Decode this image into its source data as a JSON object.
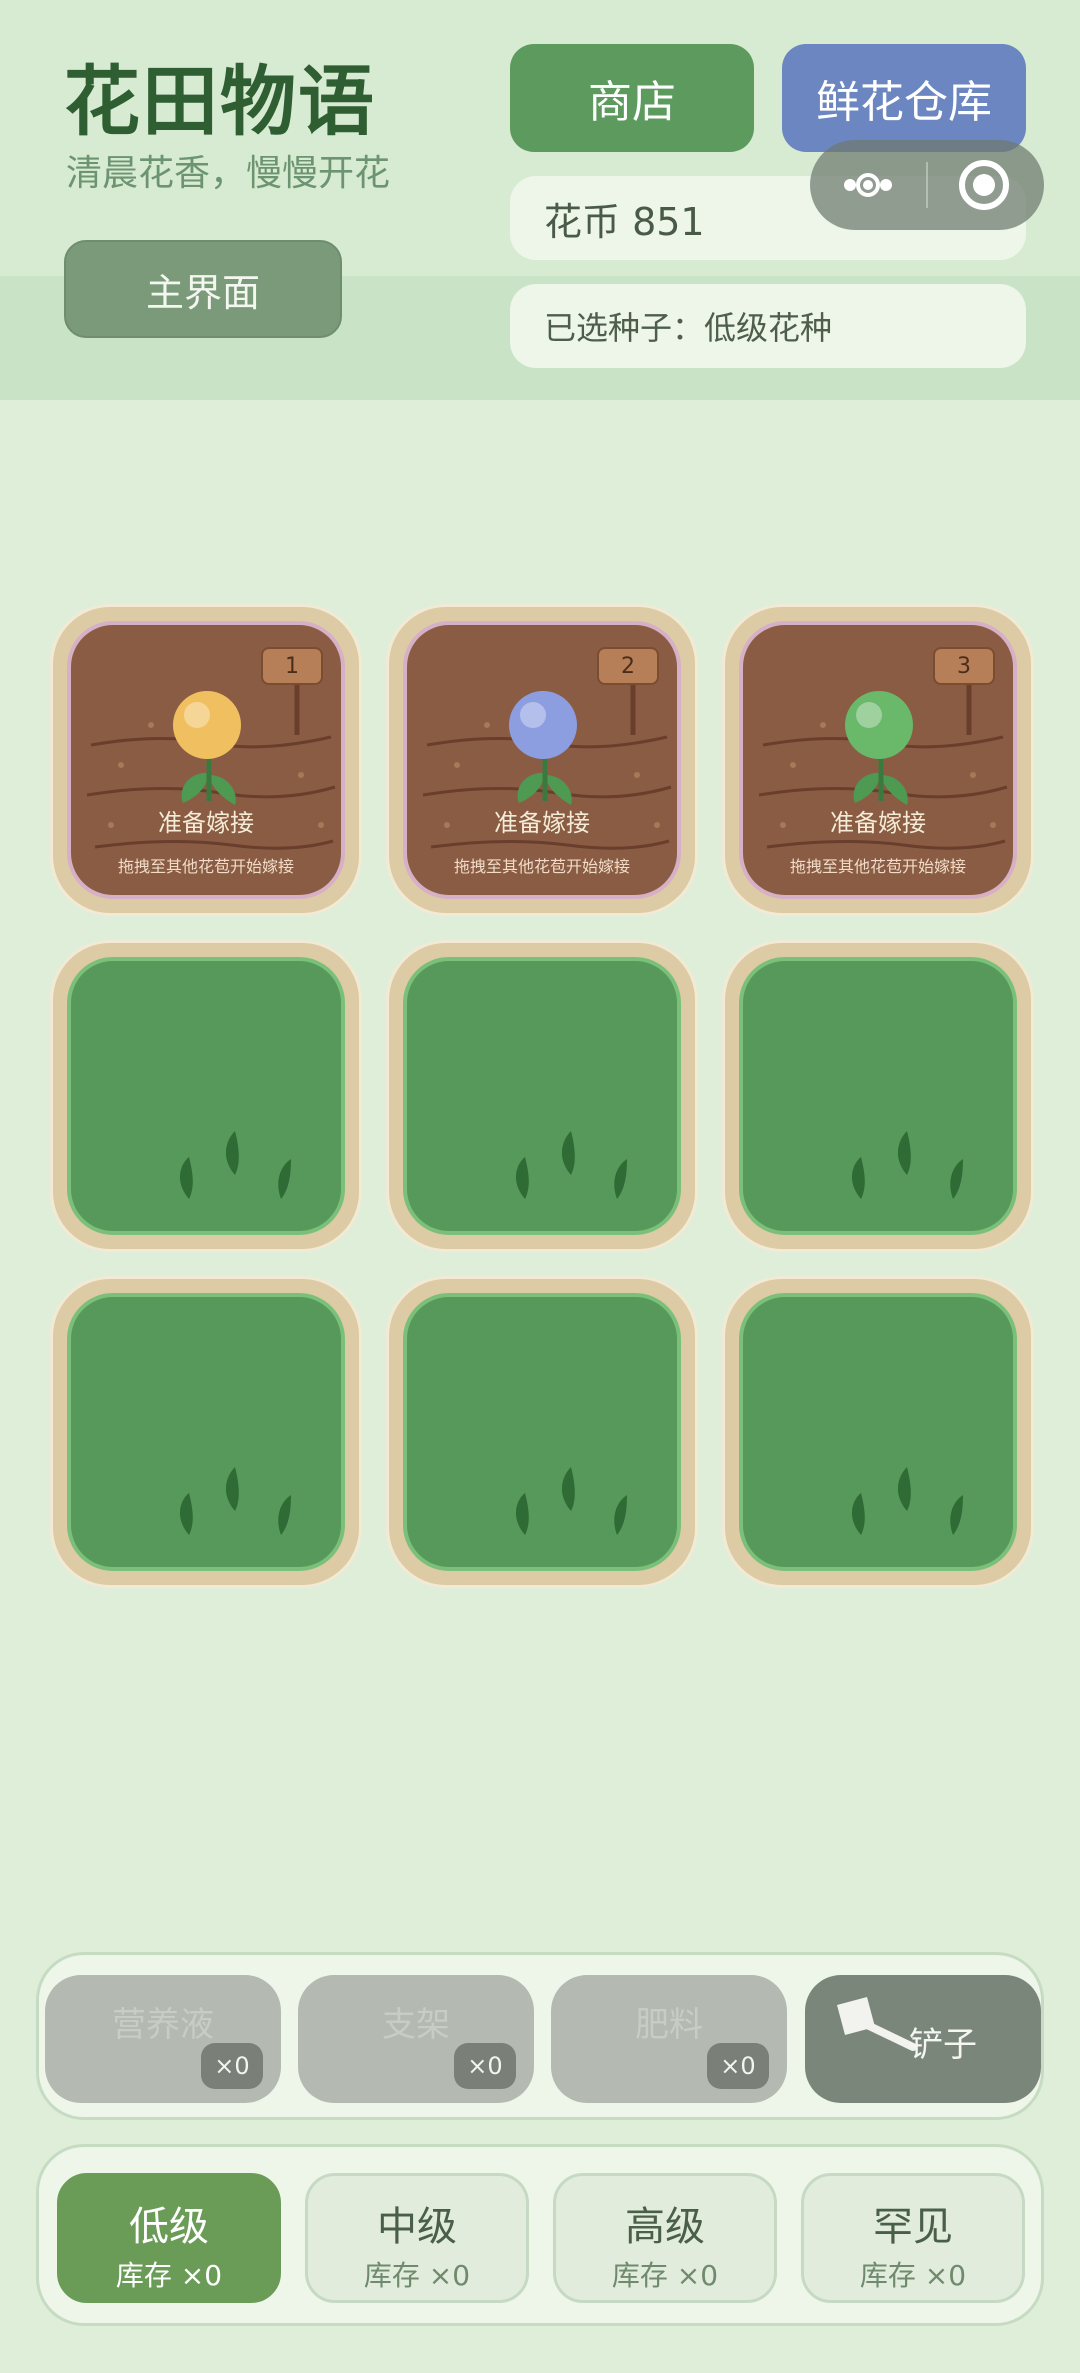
{
  "header": {
    "title": "花田物语",
    "subtitle": "清晨花香，慢慢开花",
    "main_button": "主界面",
    "shop_button": "商店",
    "warehouse_button": "鲜花仓库",
    "coins": "花币 851",
    "selected_seed": "已选种子：低级花种"
  },
  "plots": [
    {
      "state": "seedling",
      "sign": "1",
      "status": "准备嫁接",
      "hint": "拖拽至其他花苞开始嫁接",
      "bud_color": "#f0c060"
    },
    {
      "state": "seedling",
      "sign": "2",
      "status": "准备嫁接",
      "hint": "拖拽至其他花苞开始嫁接",
      "bud_color": "#8c9ee0"
    },
    {
      "state": "seedling",
      "sign": "3",
      "status": "准备嫁接",
      "hint": "拖拽至其他花苞开始嫁接",
      "bud_color": "#6ab86a"
    },
    {
      "state": "grass"
    },
    {
      "state": "grass"
    },
    {
      "state": "grass"
    },
    {
      "state": "grass"
    },
    {
      "state": "grass"
    },
    {
      "state": "grass"
    }
  ],
  "tools": [
    {
      "label": "营养液",
      "count": "×0"
    },
    {
      "label": "支架",
      "count": "×0"
    },
    {
      "label": "肥料",
      "count": "×0"
    },
    {
      "label": "铲子"
    }
  ],
  "seeds": [
    {
      "name": "低级",
      "stock": "库存 ×0",
      "active": true
    },
    {
      "name": "中级",
      "stock": "库存 ×0"
    },
    {
      "name": "高级",
      "stock": "库存 ×0"
    },
    {
      "name": "罕见",
      "stock": "库存 ×0"
    }
  ],
  "colors": {
    "background": "#dfeed8",
    "primary_green": "#5c9a5e",
    "warehouse_blue": "#6b86c0",
    "grass": "#56995a",
    "soil": "#8a5c44"
  }
}
